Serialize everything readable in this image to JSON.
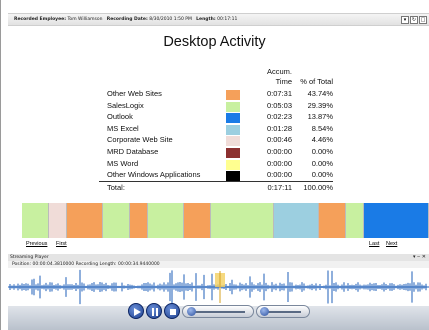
{
  "header": {
    "employee_label": "Recorded Employee:",
    "employee_value": "Tom Williamson",
    "date_label": "Recording Date:",
    "date_value": "8/30/2010 1:50 PM",
    "length_label": "Length:",
    "length_value": "00:17:11"
  },
  "report": {
    "title": "Desktop Activity",
    "col_time_line1": "Accum.",
    "col_time_line2": "Time",
    "col_pct": "% of Total",
    "rows": [
      {
        "name": "Other Web Sites",
        "color": "#f5a05a",
        "time": "0:07:31",
        "pct": "43.74%"
      },
      {
        "name": "SalesLogix",
        "color": "#c8f0a0",
        "time": "0:05:03",
        "pct": "29.39%"
      },
      {
        "name": "Outlook",
        "color": "#1a7be6",
        "time": "0:02:23",
        "pct": "13.87%"
      },
      {
        "name": "MS Excel",
        "color": "#9ccfe0",
        "time": "0:01:28",
        "pct": "8.54%"
      },
      {
        "name": "Corporate Web Site",
        "color": "#f0dcd8",
        "time": "0:00:46",
        "pct": "4.46%"
      },
      {
        "name": "MRD Database",
        "color": "#8c3030",
        "time": "0:00:00",
        "pct": "0.00%"
      },
      {
        "name": "MS Word",
        "color": "#ffff90",
        "time": "0:00:00",
        "pct": "0.00%"
      },
      {
        "name": "Other Windows Applications",
        "color": "#000000",
        "time": "0:00:00",
        "pct": "0.00%"
      }
    ],
    "total_label": "Total:",
    "total_time": "0:17:11",
    "total_pct": "100.00%"
  },
  "timeline": {
    "segments": [
      "#c8f0a0",
      "#f0dcd8",
      "#f5a05a",
      "#c8f0a0",
      "#f5a05a",
      "#c8f0a0",
      "#f5a05a",
      "#c8f0a0",
      "#9ccfe0",
      "#f5a05a",
      "#c8f0a0",
      "#1a7be6"
    ]
  },
  "nav": {
    "previous": "Previous",
    "first": "First",
    "last": "Last",
    "next": "Next"
  },
  "player": {
    "title": "Streaming Player",
    "position_text": "Position: 00:00:04.3810000   Recording Length: 00:00:34.9440000"
  }
}
